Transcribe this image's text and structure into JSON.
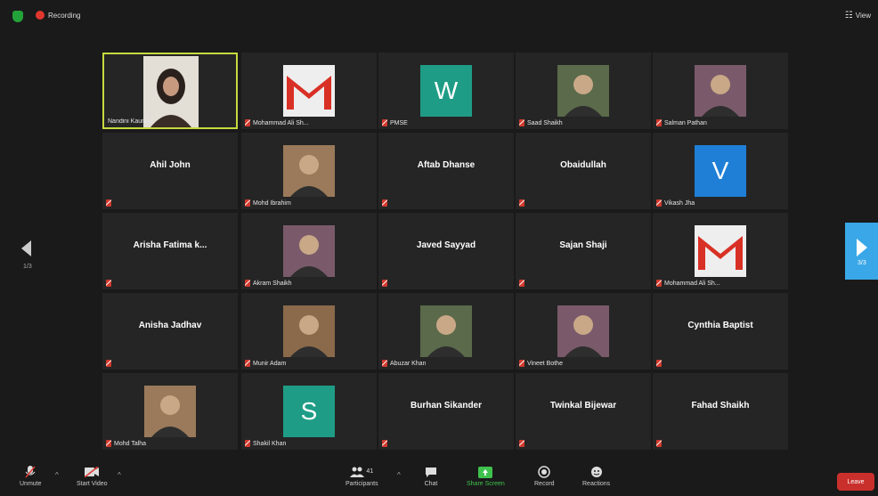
{
  "topbar": {
    "recording_label": "Recording",
    "view_label": "View"
  },
  "pagination": {
    "left_page": "1/3",
    "right_page": "3/3"
  },
  "tiles": [
    {
      "name": "Nandini Kaundal",
      "kind": "video"
    },
    {
      "name": "Mohammad Ali Sh...",
      "kind": "gmail"
    },
    {
      "name": "PMSE",
      "kind": "letter",
      "letter": "W",
      "color": "#1f9c86"
    },
    {
      "name": "Saad Shaikh",
      "kind": "photo"
    },
    {
      "name": "Salman Pathan",
      "kind": "photo"
    },
    {
      "name": "Ahil John",
      "kind": "name"
    },
    {
      "name": "Mohd Ibrahim",
      "kind": "photo"
    },
    {
      "name": "Aftab Dhanse",
      "kind": "name"
    },
    {
      "name": "Obaidullah",
      "kind": "name"
    },
    {
      "name": "Vikash Jha",
      "kind": "letter",
      "letter": "V",
      "color": "#1f7fd6"
    },
    {
      "name": "Arisha Fatima k...",
      "kind": "name"
    },
    {
      "name": "Akram Shaikh",
      "kind": "photo"
    },
    {
      "name": "Javed Sayyad",
      "kind": "name"
    },
    {
      "name": "Sajan  Shaji",
      "kind": "name"
    },
    {
      "name": "Mohammad Ali Sh...",
      "kind": "gmail"
    },
    {
      "name": "Anisha Jadhav",
      "kind": "name"
    },
    {
      "name": "Munir Adam",
      "kind": "photo"
    },
    {
      "name": "Abuzar Khan",
      "kind": "photo"
    },
    {
      "name": "Vineet Bothe",
      "kind": "photo"
    },
    {
      "name": "Cynthia Baptist",
      "kind": "name"
    },
    {
      "name": "Mohd Talha",
      "kind": "photo"
    },
    {
      "name": "Shakil Khan",
      "kind": "letter",
      "letter": "S",
      "color": "#1f9c86"
    },
    {
      "name": "Burhan Sikander",
      "kind": "name"
    },
    {
      "name": "Twinkal Bijewar",
      "kind": "name"
    },
    {
      "name": "Fahad Shaikh",
      "kind": "name"
    }
  ],
  "toolbar": {
    "unmute": "Unmute",
    "start_video": "Start Video",
    "participants": "Participants",
    "participants_count": "41",
    "chat": "Chat",
    "share_screen": "Share Screen",
    "record": "Record",
    "reactions": "Reactions",
    "leave": "Leave"
  },
  "colors": {
    "share_green": "#3ec24d",
    "leave_red": "#c9302c",
    "active_border": "#c7d93e",
    "next_blue": "#39a7e8"
  }
}
